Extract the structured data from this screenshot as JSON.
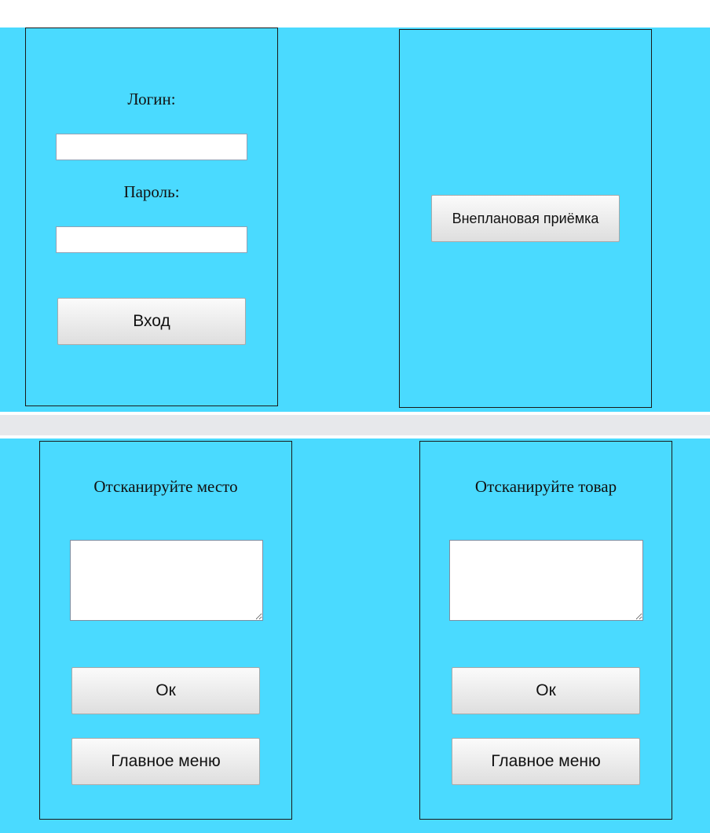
{
  "theme": {
    "background": "#4adaff",
    "divider": "#e7e8eb"
  },
  "login_panel": {
    "login_label": "Логин:",
    "login_value": "",
    "password_label": "Пароль:",
    "password_value": "",
    "enter_button": "Вход"
  },
  "menu_panel": {
    "unplanned_receipt_button": "Внеплановая приёмка"
  },
  "scan_place_panel": {
    "title": "Отсканируйте место",
    "input_value": "",
    "ok_button": "Ок",
    "main_menu_button": "Главное меню"
  },
  "scan_item_panel": {
    "title": "Отсканируйте товар",
    "input_value": "",
    "ok_button": "Ок",
    "main_menu_button": "Главное меню"
  }
}
